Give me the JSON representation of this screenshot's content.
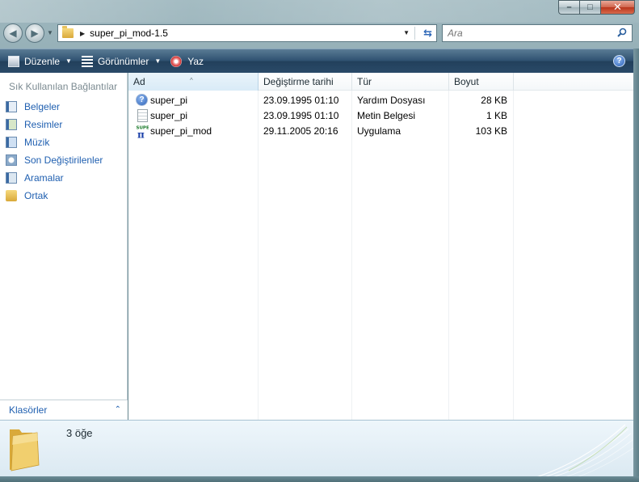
{
  "window": {
    "minimize_glyph": "–",
    "maximize_glyph": "□",
    "close_glyph": "✕"
  },
  "address": {
    "path": "super_pi_mod-1.5",
    "folder_icon": "folder-icon",
    "refresh_icon": "refresh-icon"
  },
  "search": {
    "placeholder": "Ara",
    "icon": "search-icon"
  },
  "toolbar": {
    "organize_label": "Düzenle",
    "views_label": "Görünümler",
    "burn_label": "Yaz",
    "help_glyph": "?"
  },
  "nav_pane": {
    "favorites_title": "Sık Kullanılan Bağlantılar",
    "links": [
      {
        "label": "Belgeler",
        "icon": "documents-icon"
      },
      {
        "label": "Resimler",
        "icon": "pictures-icon"
      },
      {
        "label": "Müzik",
        "icon": "music-icon"
      },
      {
        "label": "Son Değiştirilenler",
        "icon": "recent-icon"
      },
      {
        "label": "Aramalar",
        "icon": "searches-icon"
      },
      {
        "label": "Ortak",
        "icon": "public-folder-icon"
      }
    ],
    "folders_label": "Klasörler",
    "folders_chevron": "⌃"
  },
  "file_list": {
    "columns": [
      "Ad",
      "Değiştirme tarihi",
      "Tür",
      "Boyut"
    ],
    "files": [
      {
        "name": "super_pi",
        "date": "23.09.1995 01:10",
        "type": "Yardım Dosyası",
        "size": "28 KB",
        "icon": "help-file-icon"
      },
      {
        "name": "super_pi",
        "date": "23.09.1995 01:10",
        "type": "Metin Belgesi",
        "size": "1 KB",
        "icon": "text-file-icon"
      },
      {
        "name": "super_pi_mod",
        "date": "29.11.2005 20:16",
        "type": "Uygulama",
        "size": "103 KB",
        "icon": "super-pi-app-icon"
      }
    ]
  },
  "details": {
    "item_count": "3 öğe"
  },
  "colors": {
    "link_blue": "#1f5fb0",
    "toolbar_dark": "#2a4a68",
    "frame": "#7d9aa3"
  }
}
